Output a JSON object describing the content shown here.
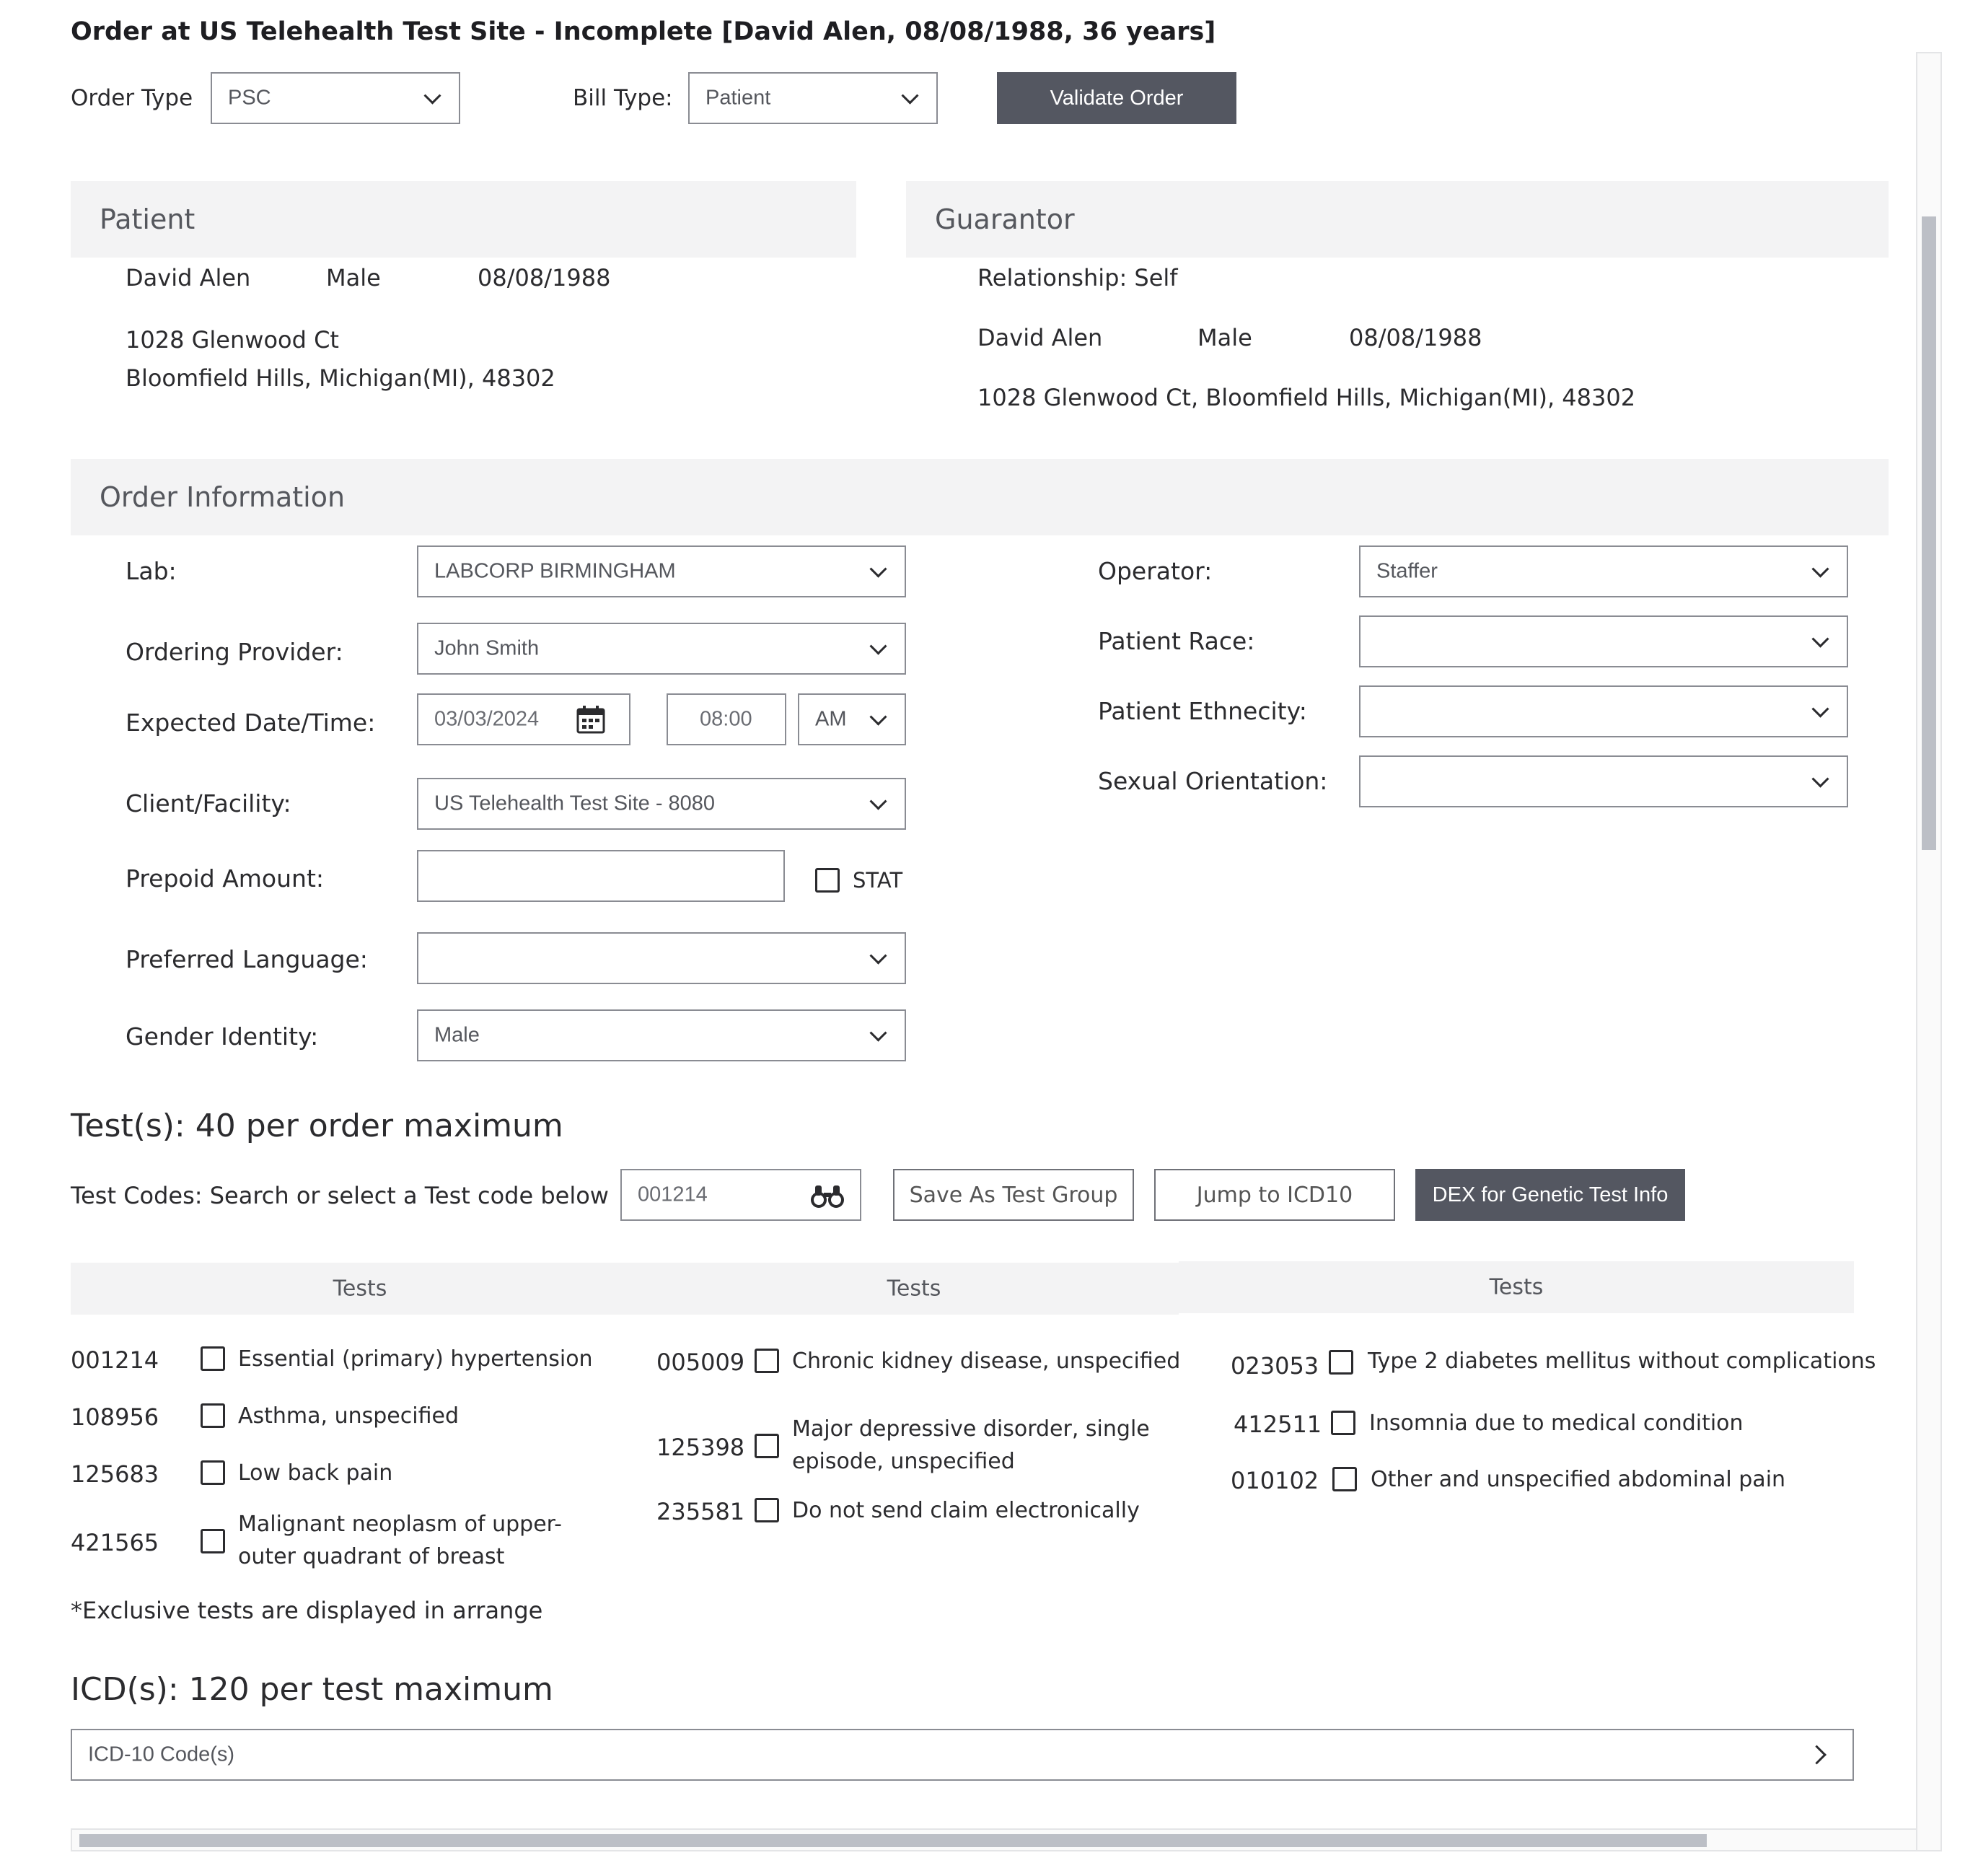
{
  "header": {
    "title": "Order at US Telehealth Test Site - Incomplete [David Alen, 08/08/1988, 36 years]",
    "order_type_label": "Order Type",
    "order_type_value": "PSC",
    "bill_type_label": "Bill Type:",
    "bill_type_value": "Patient",
    "validate_label": "Validate Order"
  },
  "patient": {
    "heading": "Patient",
    "name": "David Alen",
    "sex": "Male",
    "dob": "08/08/1988",
    "address1": "1028 Glenwood Ct",
    "address2": "Bloomfield Hills, Michigan(MI), 48302"
  },
  "guarantor": {
    "heading": "Guarantor",
    "relationship": "Relationship: Self",
    "name": "David Alen",
    "sex": "Male",
    "dob": "08/08/1988",
    "address": "1028 Glenwood Ct, Bloomfield Hills, Michigan(MI), 48302"
  },
  "order_info": {
    "heading": "Order Information",
    "lab_label": "Lab:",
    "lab_value": "LABCORP BIRMINGHAM",
    "provider_label": "Ordering Provider:",
    "provider_value": "John Smith",
    "datetime_label": "Expected Date/Time:",
    "date_value": "03/03/2024",
    "time_value": "08:00",
    "ampm_value": "AM",
    "client_label": "Client/Facility:",
    "client_value": "US Telehealth Test Site - 8080",
    "prepaid_label": "Prepoid Amount:",
    "prepaid_value": "",
    "stat_label": "STAT",
    "language_label": "Preferred Language:",
    "language_value": "",
    "gender_label": "Gender Identity:",
    "gender_value": "Male",
    "operator_label": "Operator:",
    "operator_value": "Staffer",
    "race_label": "Patient Race:",
    "race_value": "",
    "ethnicity_label": "Patient Ethnecity:",
    "ethnicity_value": "",
    "orientation_label": "Sexual Orientation:",
    "orientation_value": ""
  },
  "tests": {
    "heading": "Test(s): 40 per order maximum",
    "search_label": "Test Codes: Search or select a Test code below",
    "search_value": "001214",
    "save_group_label": "Save As Test Group",
    "jump_label": "Jump to ICD10",
    "dex_label": "DEX for Genetic Test Info",
    "col_header": "Tests",
    "col1": [
      {
        "code": "001214",
        "name": "Essential (primary) hypertension"
      },
      {
        "code": "108956",
        "name": "Asthma, unspecified"
      },
      {
        "code": "125683",
        "name": "Low back pain"
      },
      {
        "code": "421565",
        "name": "Malignant neoplasm of upper-outer quadrant of breast"
      }
    ],
    "col2": [
      {
        "code": "005009",
        "name": "Chronic kidney disease, unspecified"
      },
      {
        "code": "125398",
        "name": "Major depressive disorder, single episode, unspecified"
      },
      {
        "code": "235581",
        "name": "Do not send claim electronically"
      }
    ],
    "col3": [
      {
        "code": "023053",
        "name": "Type 2 diabetes mellitus without complications"
      },
      {
        "code": "412511",
        "name": "Insomnia due to medical condition"
      },
      {
        "code": "010102",
        "name": "Other and unspecified abdominal pain"
      }
    ],
    "note": "*Exclusive tests are displayed in arrange"
  },
  "icd": {
    "heading": "ICD(s): 120 per test maximum",
    "accordion_label": "ICD-10 Code(s)"
  },
  "colors": {
    "dark_button": "#545761",
    "section_bg": "#f3f3f4",
    "scrollbar_thumb": "#bcbfc6"
  }
}
